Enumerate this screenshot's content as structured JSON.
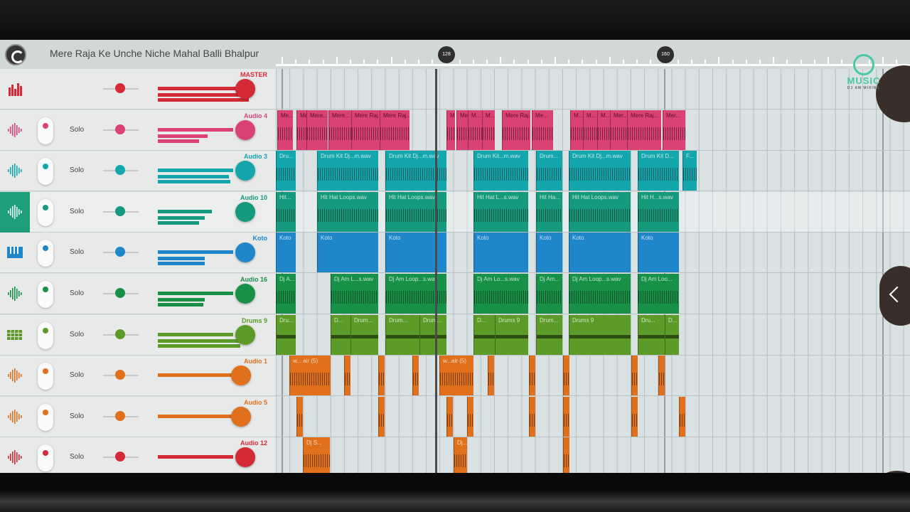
{
  "song_title": "Mere Raja Ke Unche Niche Mahal Balli Bhalpur",
  "ruler": {
    "marker_1": "128",
    "marker_2": "160"
  },
  "solo_label": "Solo",
  "watermark": {
    "title": "MUSIC",
    "subtitle": "DJ AM MIXING"
  },
  "colors": {
    "red": "#d42a35",
    "pink": "#d94272",
    "cyan": "#13a7ad",
    "teal": "#159a7d",
    "blue": "#1e86c9",
    "green": "#179048",
    "olive": "#5c9b27",
    "orange": "#e0701c"
  },
  "tracks": [
    {
      "name": "MASTER",
      "icon": "equalizer-icon",
      "color": "#d42a35"
    },
    {
      "name": "Audio 4",
      "icon": "waveform-icon",
      "color": "#d94272"
    },
    {
      "name": "Audio 3",
      "icon": "waveform-icon",
      "color": "#13a7ad"
    },
    {
      "name": "Audio 10",
      "icon": "waveform-icon",
      "color": "#159a7d"
    },
    {
      "name": "Koto",
      "icon": "piano-icon",
      "color": "#1e86c9"
    },
    {
      "name": "Audio 16",
      "icon": "waveform-icon",
      "color": "#179048"
    },
    {
      "name": "Drums 9",
      "icon": "drum-pads-icon",
      "color": "#5c9b27"
    },
    {
      "name": "Audio 1",
      "icon": "waveform-icon",
      "color": "#e0701c"
    },
    {
      "name": "Audio 5",
      "icon": "waveform-icon",
      "color": "#e0701c"
    },
    {
      "name": "Audio 12",
      "icon": "waveform-icon",
      "color": "#d42a35"
    }
  ],
  "clips": {
    "audio4": [
      "Me...",
      "Me",
      "Mere...",
      "Mere...",
      "Mere Raj...",
      "Mere Raj...",
      "Me",
      "Me...",
      "M...",
      "M...",
      "Mere Raj...",
      "Me...",
      "M...",
      "M...",
      "M...",
      "Mer...",
      "Mere Raj...",
      "Mer..."
    ],
    "audio3": [
      "Dru...",
      "Drum Kit Dj...m.wav",
      "Drum Kit Dj...m.wav",
      "Drum Kit...m.wav",
      "Drum...",
      "Drum Kit Dj...m.wav",
      "Drum Kit D...",
      "F..."
    ],
    "audio10": [
      "Hit...",
      "Hit Hat Loops.wav",
      "Hit Hat Loops.wav",
      "Hit Hat L...s.wav",
      "Hit Ha...",
      "Hit Hat Loops.wav",
      "Hit H...s.wav"
    ],
    "koto": [
      "Koto",
      "Koto",
      "Koto",
      "Koto",
      "Koto",
      "Koto",
      "Koto"
    ],
    "audio16": [
      "Dj A...",
      "Dj Am L...s.wav",
      "Dj Am Loop...s.wav",
      "Dj Am Lo...s.wav",
      "Dj Am...",
      "Dj Am Loop...s.wav",
      "Dj Am Loo..."
    ],
    "drums9": [
      "Dru...",
      "D...",
      "Drum...",
      "Drum...",
      "Drum...",
      "D...",
      "Drums 9",
      "Drum...",
      "Drums 9",
      "Dru...",
      "D..."
    ],
    "audio1": [
      "w... air (5)",
      "",
      "",
      "",
      "w...air (5)",
      "",
      "",
      "",
      "",
      ""
    ],
    "audio5": [
      "",
      "",
      "",
      "",
      "",
      "",
      "",
      ""
    ],
    "audio12": [
      "Dj S...",
      "Dj...",
      ""
    ]
  }
}
